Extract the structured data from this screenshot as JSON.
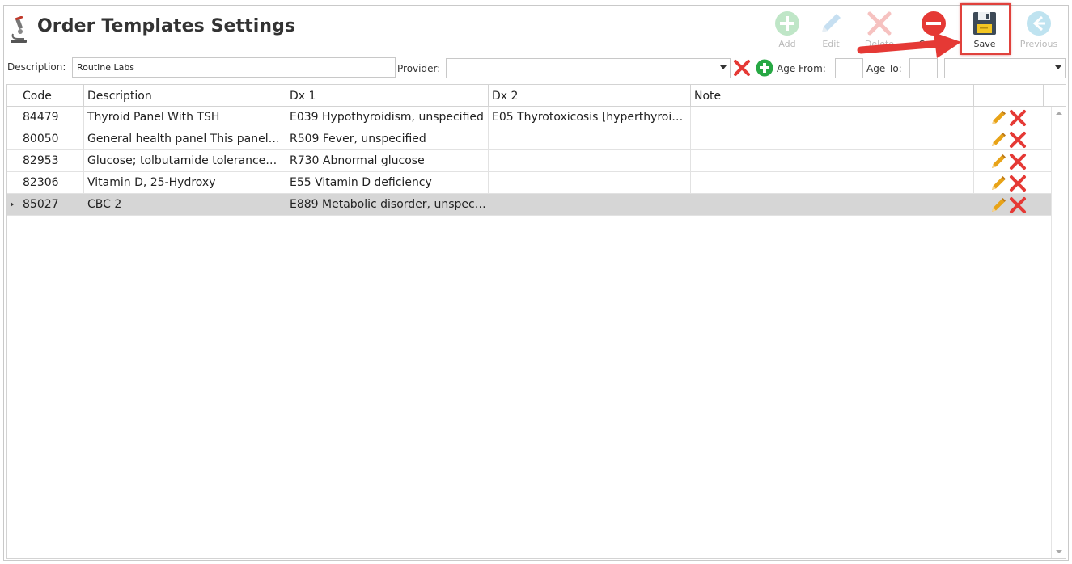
{
  "header": {
    "title": "Order Templates Settings"
  },
  "toolbar": {
    "add_label": "Add",
    "edit_label": "Edit",
    "delete_label": "Delete",
    "cancel_label": "Cancel",
    "save_label": "Save",
    "previous_label": "Previous"
  },
  "filters": {
    "description_label": "Description:",
    "description_value": "Routine Labs",
    "provider_label": "Provider:",
    "provider_value": "",
    "age_from_label": "Age From:",
    "age_from_value": "",
    "age_to_label": "Age To:",
    "age_to_value": "",
    "age_unit_value": ""
  },
  "grid": {
    "columns": [
      "Code",
      "Description",
      "Dx 1",
      "Dx 2",
      "Note"
    ],
    "rows": [
      {
        "code": "84479",
        "description": "Thyroid Panel With TSH",
        "dx1": "E039 Hypothyroidism, unspecified",
        "dx2": "E05 Thyrotoxicosis [hyperthyroi…",
        "note": ""
      },
      {
        "code": "80050",
        "description": "General health panel This panel…",
        "dx1": "R509 Fever, unspecified",
        "dx2": "",
        "note": ""
      },
      {
        "code": "82953",
        "description": "Glucose; tolbutamide tolerance…",
        "dx1": "R730 Abnormal glucose",
        "dx2": "",
        "note": ""
      },
      {
        "code": "82306",
        "description": "Vitamin D, 25-Hydroxy",
        "dx1": "E55 Vitamin D deficiency",
        "dx2": "",
        "note": ""
      },
      {
        "code": "85027",
        "description": "CBC 2",
        "dx1": "E889 Metabolic disorder, unspec…",
        "dx2": "",
        "note": ""
      }
    ],
    "selected_row": 4
  },
  "colors": {
    "highlight": "#e0413c",
    "selected_row": "#d6d6d6",
    "edit_icon": "#e8a317",
    "delete_icon": "#e53935",
    "add_icon": "#27a844"
  }
}
